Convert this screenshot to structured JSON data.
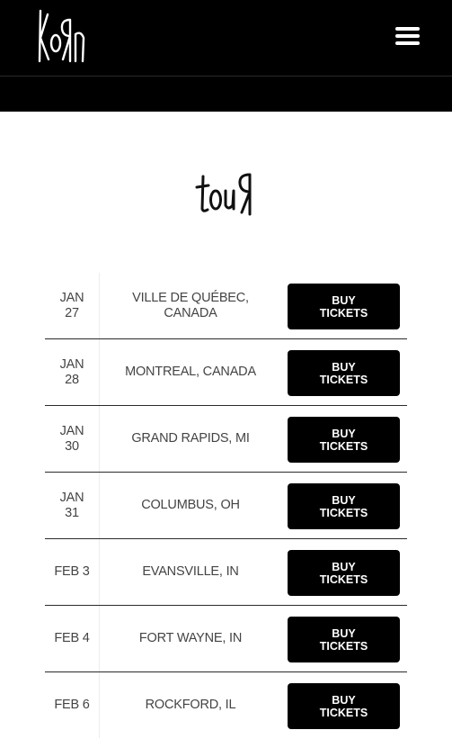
{
  "header": {
    "logo_text": "KoRn",
    "menu_icon": "hamburger-menu-icon",
    "background": "#000000"
  },
  "section": {
    "title": "touR"
  },
  "tour": {
    "button_color": "#000000",
    "rows": [
      {
        "date": "JAN 27",
        "city": "VILLE DE QUÉBEC, CANADA",
        "button": "BUY TICKETS"
      },
      {
        "date": "JAN 28",
        "city": "MONTREAL, CANADA",
        "button": "BUY TICKETS"
      },
      {
        "date": "JAN 30",
        "city": "GRAND RAPIDS, MI",
        "button": "BUY TICKETS"
      },
      {
        "date": "JAN 31",
        "city": "COLUMBUS, OH",
        "button": "BUY TICKETS"
      },
      {
        "date": "FEB 3",
        "city": "EVANSVILLE, IN",
        "button": "BUY TICKETS"
      },
      {
        "date": "FEB 4",
        "city": "FORT WAYNE, IN",
        "button": "BUY TICKETS"
      },
      {
        "date": "FEB 6",
        "city": "ROCKFORD, IL",
        "button": "BUY TICKETS"
      }
    ]
  }
}
